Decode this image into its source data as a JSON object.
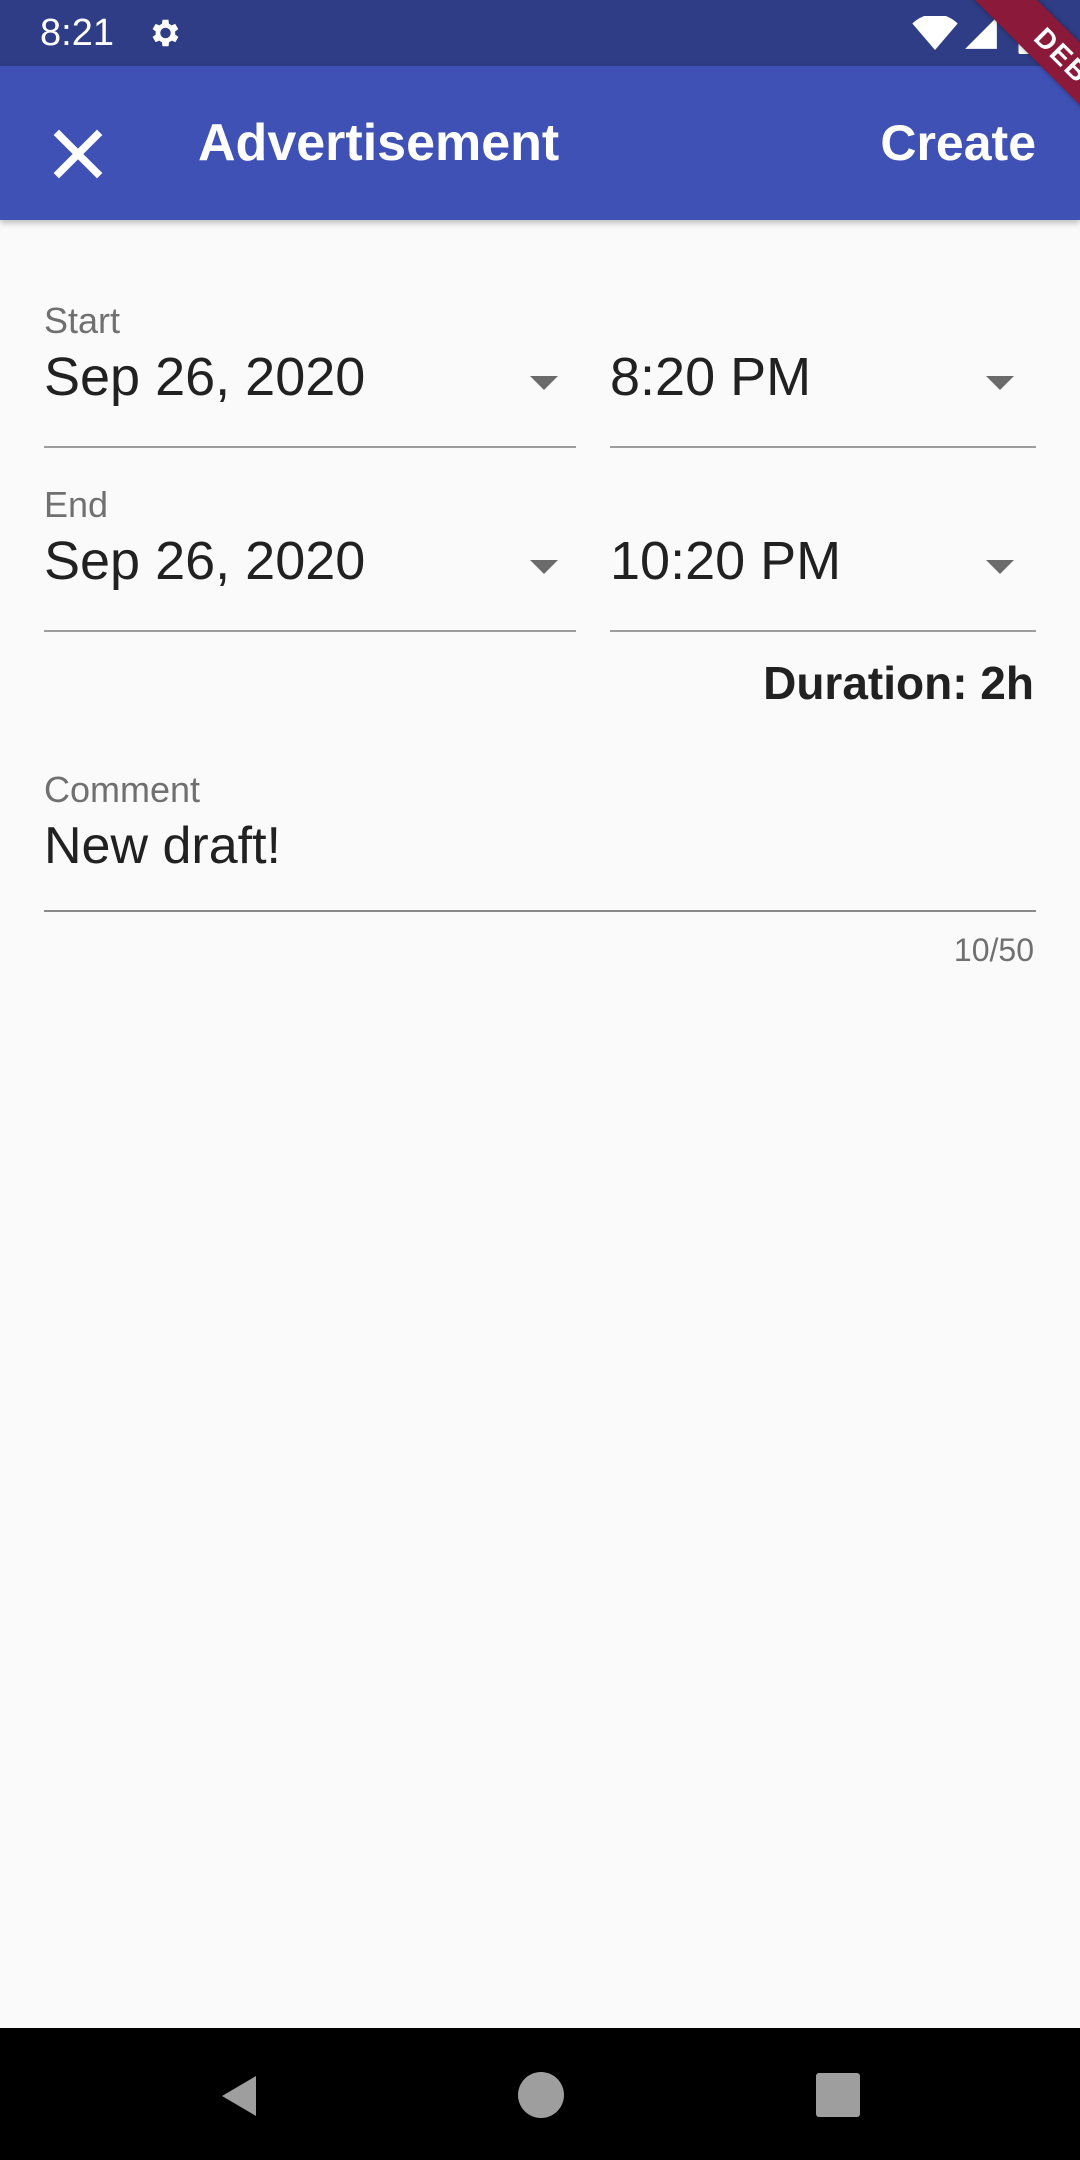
{
  "status_bar": {
    "time": "8:21",
    "icons": [
      "gear-icon",
      "wifi-icon",
      "signal-icon",
      "battery-icon"
    ]
  },
  "app_bar": {
    "title": "Advertisement",
    "action_label": "Create",
    "close_icon": "close-icon",
    "background_color": "#3f51b5"
  },
  "debug_ribbon": {
    "label": "DEBUG",
    "color": "#8b1a3a"
  },
  "form": {
    "start": {
      "label": "Start",
      "date": "Sep 26, 2020",
      "time": "8:20 PM"
    },
    "end": {
      "label": "End",
      "date": "Sep 26, 2020",
      "time": "10:20 PM"
    },
    "duration": "Duration: 2h",
    "comment": {
      "label": "Comment",
      "value": "New draft!",
      "counter": "10/50"
    }
  },
  "nav_bar": {
    "icons": [
      "back-icon",
      "home-icon",
      "recent-apps-icon"
    ]
  }
}
